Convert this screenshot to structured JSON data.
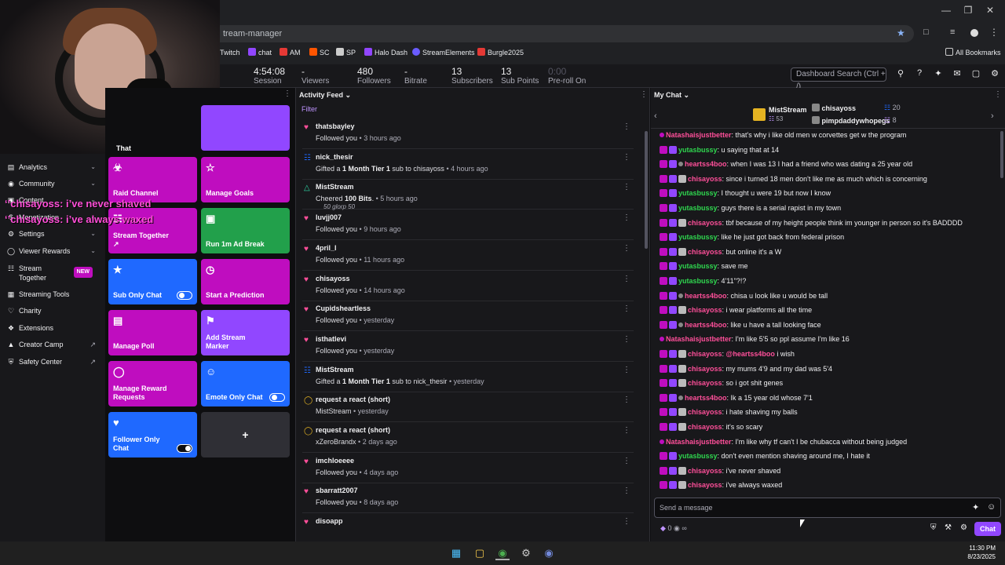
{
  "browser": {
    "url": "tream-manager",
    "bookmarks": [
      {
        "label": "Twitch",
        "color": "#9146ff"
      },
      {
        "label": "chat",
        "color": "#9146ff"
      },
      {
        "label": "AM",
        "color": "#e53935"
      },
      {
        "label": "SC",
        "color": "#ff5500"
      },
      {
        "label": "SP",
        "color": "#cccccc"
      },
      {
        "label": "Halo Dash",
        "color": "#9146ff"
      },
      {
        "label": "StreamElements",
        "color": "#6a5cff"
      },
      {
        "label": "Burgle2025",
        "color": "#e53935"
      }
    ],
    "all_bookmarks": "All Bookmarks"
  },
  "stats": [
    {
      "value": "4:54:08",
      "label": "Session"
    },
    {
      "value": "-",
      "label": "Viewers"
    },
    {
      "value": "480",
      "label": "Followers"
    },
    {
      "value": "-",
      "label": "Bitrate"
    },
    {
      "value": "13",
      "label": "Subscribers"
    },
    {
      "value": "13",
      "label": "Sub Points"
    },
    {
      "value": "0:00",
      "label": "Pre-roll On"
    }
  ],
  "dashboard_search": "Dashboard Search (Ctrl + /)",
  "overlay": {
    "line1": "‘’chisayoss: i’ve never shaved",
    "line2": "‘’chisayoss: i’ve always waxed"
  },
  "sidebar": {
    "items": [
      {
        "label": "Analytics",
        "icon": "chart-icon",
        "chev": true
      },
      {
        "label": "Community",
        "icon": "community-icon",
        "chev": true
      },
      {
        "label": "Content",
        "icon": "content-icon",
        "chev": true
      },
      {
        "label": "Monetization",
        "icon": "monetization-icon",
        "chev": true
      },
      {
        "label": "Settings",
        "icon": "settings-icon",
        "chev": true
      },
      {
        "label": "Viewer Rewards",
        "icon": "rewards-icon",
        "chev": true
      },
      {
        "label": "Stream Together",
        "icon": "stream-together-icon",
        "badge": "NEW"
      },
      {
        "label": "Streaming Tools",
        "icon": "tools-icon"
      },
      {
        "label": "Charity",
        "icon": "charity-icon"
      },
      {
        "label": "Extensions",
        "icon": "extensions-icon"
      },
      {
        "label": "Creator Camp",
        "icon": "camp-icon",
        "ext": true
      },
      {
        "label": "Safety Center",
        "icon": "safety-icon",
        "ext": true
      }
    ]
  },
  "quick_actions": {
    "head_tile": "That",
    "tiles": [
      {
        "label": "Raid Channel",
        "color": "#bf0dbf",
        "icon": "raid-icon"
      },
      {
        "label": "Manage Goals",
        "color": "#bf0dbf",
        "icon": "star-icon"
      },
      {
        "label": "Stream Together ↗",
        "color": "#bf0dbf",
        "icon": "stream-together-icon"
      },
      {
        "label": "Run 1m Ad Break",
        "color": "#22a04b",
        "icon": "ad-icon"
      },
      {
        "label": "Sub Only Chat",
        "color": "#1f69ff",
        "icon": "star-icon",
        "toggle": "off"
      },
      {
        "label": "Start a Prediction",
        "color": "#bf0dbf",
        "icon": "prediction-icon"
      },
      {
        "label": "Manage Poll",
        "color": "#bf0dbf",
        "icon": "poll-icon"
      },
      {
        "label": "Add Stream Marker",
        "color": "#9147ff",
        "icon": "marker-icon"
      },
      {
        "label": "Manage Reward Requests",
        "color": "#bf0dbf",
        "icon": "reward-icon"
      },
      {
        "label": "Emote Only Chat",
        "color": "#1f69ff",
        "icon": "emote-icon",
        "toggle": "off"
      },
      {
        "label": "Follower Only Chat",
        "color": "#1f69ff",
        "icon": "heart-icon",
        "toggle": "on"
      }
    ],
    "add_label": "+"
  },
  "activity_feed": {
    "title": "Activity Feed",
    "filter": "Filter",
    "items": [
      {
        "type": "follow",
        "name": "thatsbayley",
        "text": "Followed you",
        "time": "3 hours ago"
      },
      {
        "type": "gift",
        "name": "nick_thesir",
        "text": "Gifted a ",
        "bold": "1 Month Tier 1",
        "tail": " sub to chisayoss",
        "time": "4 hours ago"
      },
      {
        "type": "cheer",
        "name": "MistStream",
        "text": "Cheered ",
        "bold": "100 Bits",
        "tail": ".",
        "time": "5 hours ago",
        "bits": "50 glorp    50"
      },
      {
        "type": "follow",
        "name": "luvjj007",
        "text": "Followed you",
        "time": "9 hours ago"
      },
      {
        "type": "follow",
        "name": "4pril_l",
        "text": "Followed you",
        "time": "11 hours ago"
      },
      {
        "type": "follow",
        "name": "chisayoss",
        "text": "Followed you",
        "time": "14 hours ago"
      },
      {
        "type": "follow",
        "name": "Cupidsheartless",
        "text": "Followed you",
        "time": "yesterday"
      },
      {
        "type": "follow",
        "name": "isthatlevi",
        "text": "Followed you",
        "time": "yesterday"
      },
      {
        "type": "gift",
        "name": "MistStream",
        "text": "Gifted a ",
        "bold": "1 Month Tier 1",
        "tail": " sub to nick_thesir",
        "time": "yesterday"
      },
      {
        "type": "reward",
        "name": "request a react (short)",
        "text": "MistStream",
        "time": "yesterday"
      },
      {
        "type": "reward",
        "name": "request a react (short)",
        "text": "xZeroBrandx",
        "time": "2 days ago"
      },
      {
        "type": "follow",
        "name": "imchloeeee",
        "text": "Followed you",
        "time": "4 days ago"
      },
      {
        "type": "follow",
        "name": "sbarratt2007",
        "text": "Followed you",
        "time": "8 days ago"
      },
      {
        "type": "follow",
        "name": "disoapp",
        "text": "",
        "time": ""
      }
    ]
  },
  "chat": {
    "title": "My Chat",
    "hype": {
      "name1": "MistStream",
      "count1": "53",
      "name2": "chisayoss",
      "count2": "20",
      "name3": "pimpdaddywhopegs",
      "count3": "8"
    },
    "messages": [
      {
        "user": "Natashaisjustbetter",
        "color": "#ff4f9a",
        "text": "that's why i like old men w corvettes get w the program"
      },
      {
        "user": "yutasbussy",
        "color": "#2fd64f",
        "text": "u saying that at 14"
      },
      {
        "user": "heartss4boo",
        "color": "#ff4f9a",
        "text": "when I was 13 I had a friend who was dating a 25 year old"
      },
      {
        "user": "chisayoss",
        "color": "#ff4f9a",
        "text": "since i turned 18 men don't like me as much which is concerning"
      },
      {
        "user": "yutasbussy",
        "color": "#2fd64f",
        "text": "I thought u were 19 but now I know"
      },
      {
        "user": "yutasbussy",
        "color": "#2fd64f",
        "text": "guys there is a serial rapist in my town"
      },
      {
        "user": "chisayoss",
        "color": "#ff4f9a",
        "text": "tbf because of my height people think im younger in person so it's BADDDD"
      },
      {
        "user": "yutasbussy",
        "color": "#2fd64f",
        "text": "like he just got back from federal prison"
      },
      {
        "user": "chisayoss",
        "color": "#ff4f9a",
        "text": "but online it's a W"
      },
      {
        "user": "yutasbussy",
        "color": "#2fd64f",
        "text": "save me"
      },
      {
        "user": "yutasbussy",
        "color": "#2fd64f",
        "text": "4'11\"?!?"
      },
      {
        "user": "heartss4boo",
        "color": "#ff4f9a",
        "text": "chisa u look like u would be tall"
      },
      {
        "user": "chisayoss",
        "color": "#ff4f9a",
        "text": "i wear platforms all the time"
      },
      {
        "user": "heartss4boo",
        "color": "#ff4f9a",
        "text": "like u have a tall looking face"
      },
      {
        "user": "Natashaisjustbetter",
        "color": "#ff4f9a",
        "text": "I'm like 5'5 so ppl assume I'm like 16"
      },
      {
        "user": "chisayoss",
        "color": "#ff4f9a",
        "text": "@heartss4boo i wish",
        "mention": "@heartss4boo"
      },
      {
        "user": "chisayoss",
        "color": "#ff4f9a",
        "text": "my mums 4'9 and my dad was 5'4"
      },
      {
        "user": "chisayoss",
        "color": "#ff4f9a",
        "text": "so i got shit genes"
      },
      {
        "user": "heartss4boo",
        "color": "#ff4f9a",
        "text": "Ik a 15 year old whose 7'1"
      },
      {
        "user": "chisayoss",
        "color": "#ff4f9a",
        "text": "i hate shaving my balls"
      },
      {
        "user": "chisayoss",
        "color": "#ff4f9a",
        "text": "it's so scary"
      },
      {
        "user": "Natashaisjustbetter",
        "color": "#ff4f9a",
        "text": "I'm like why tf can't I be chubacca without being judged"
      },
      {
        "user": "yutasbussy",
        "color": "#2fd64f",
        "text": "don't even mention shaving around me, I hate it"
      },
      {
        "user": "chisayoss",
        "color": "#ff4f9a",
        "text": "i've never shaved"
      },
      {
        "user": "chisayoss",
        "color": "#ff4f9a",
        "text": "i've always waxed"
      }
    ],
    "input_placeholder": "Send a message",
    "points": "0",
    "chat_button": "Chat"
  },
  "taskbar": {
    "time": "11:30 PM",
    "date": "8/23/2025"
  }
}
